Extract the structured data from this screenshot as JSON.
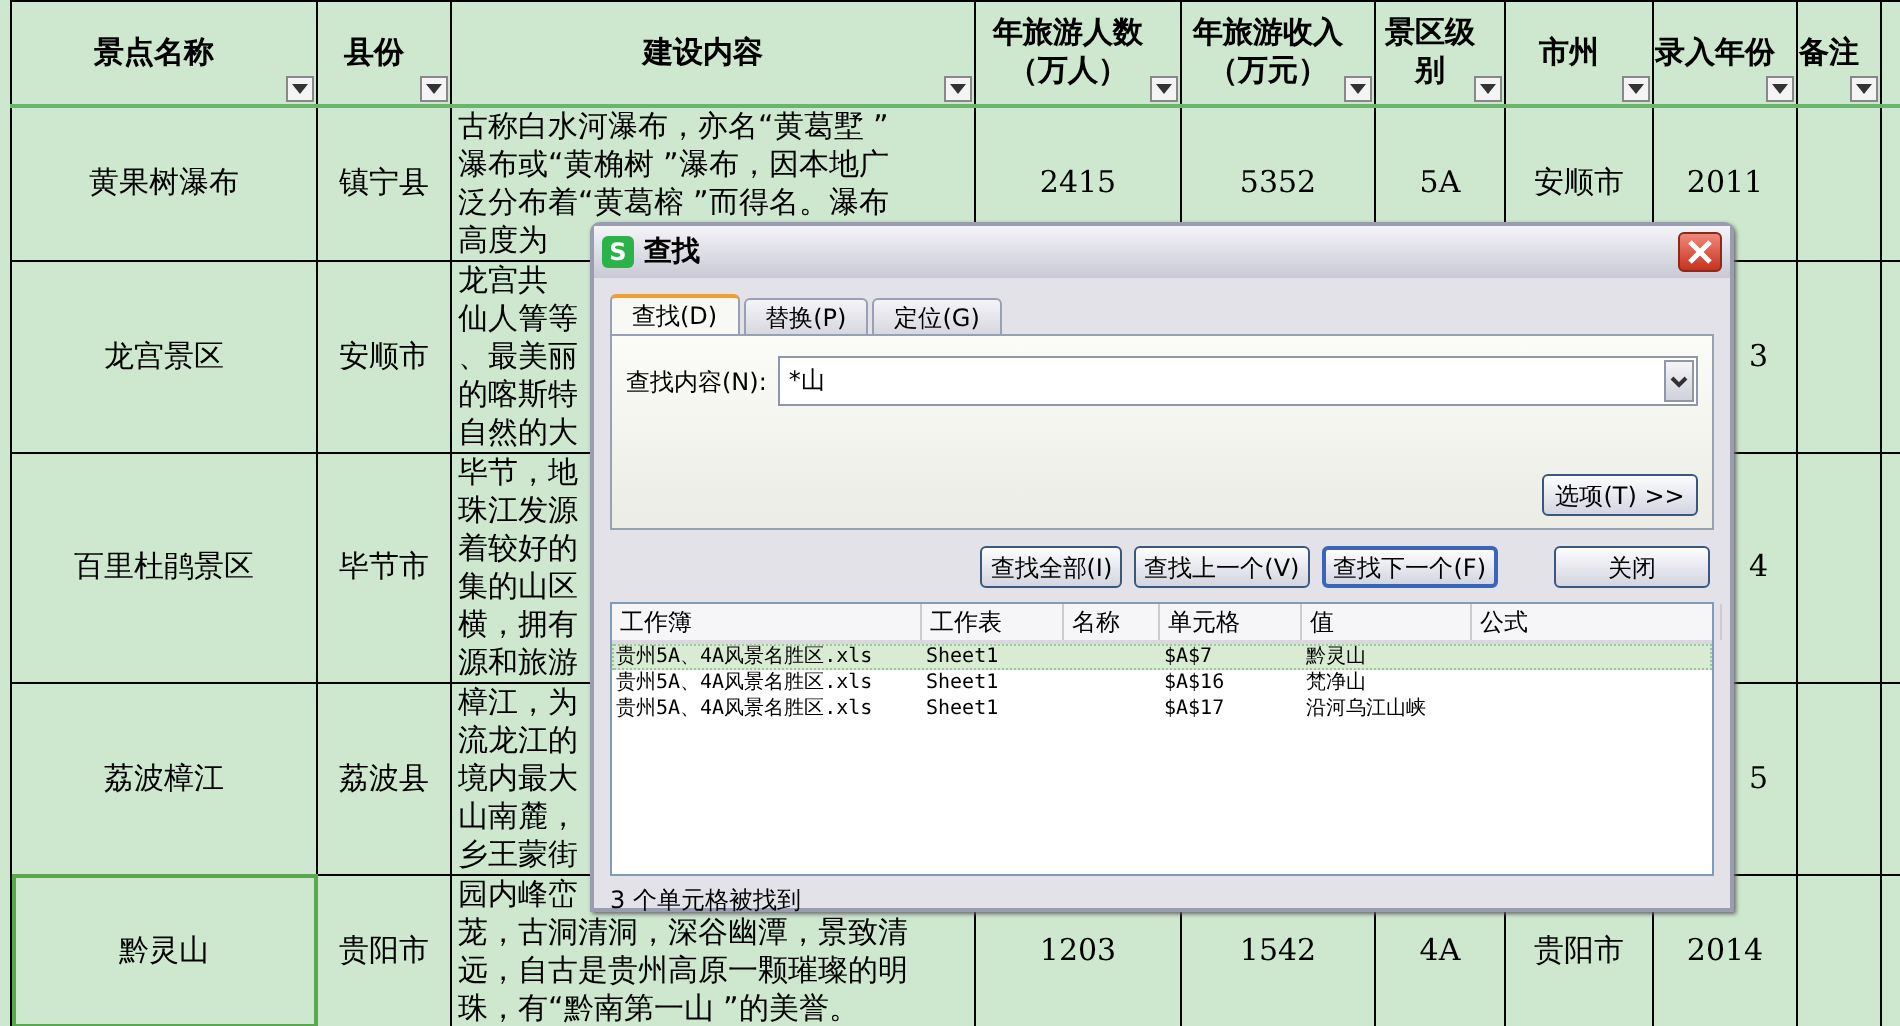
{
  "sheet": {
    "columns": [
      {
        "lines": [
          "景点名称"
        ]
      },
      {
        "lines": [
          "县份"
        ]
      },
      {
        "lines": [
          "建设内容"
        ]
      },
      {
        "lines": [
          "年旅游人数",
          "（万人）"
        ]
      },
      {
        "lines": [
          "年旅游收入",
          "（万元）"
        ]
      },
      {
        "lines": [
          "景区级",
          "别"
        ]
      },
      {
        "lines": [
          "市州"
        ]
      },
      {
        "lines": [
          "录入年份"
        ]
      },
      {
        "lines": [
          "备注"
        ]
      }
    ],
    "rows": [
      {
        "name": "黄果树瀑布",
        "county": "镇宁县",
        "description": [
          "古称白水河瀑布，亦名“黄葛墅 ”",
          "瀑布或“黄桷树 ”瀑布，因本地广",
          "泛分布着“黄葛榕 ”而得名。瀑布",
          "高度为"
        ],
        "visitors": "2415",
        "revenue": "5352",
        "grade": "5A",
        "city": "安顺市",
        "year": "2011",
        "selected": false
      },
      {
        "name": "龙宫景区",
        "county": "安顺市",
        "description": [
          "龙宫共",
          "仙人箐等",
          "、最美丽",
          "的喀斯特",
          "自然的大"
        ],
        "year": "3",
        "selected": false
      },
      {
        "name": "百里杜鹃景区",
        "county": "毕节市",
        "description": [
          "毕节，地",
          "珠江发源",
          "着较好的",
          "集的山区",
          "横，拥有",
          "源和旅游"
        ],
        "year": "4",
        "selected": false
      },
      {
        "name": "荔波樟江",
        "county": "荔波县",
        "description": [
          "樟江，为",
          "流龙江的",
          "境内最大",
          "山南麓，",
          "乡王蒙街"
        ],
        "year": "5",
        "selected": false
      },
      {
        "name": "黔灵山",
        "county": "贵阳市",
        "description": [
          "园内峰峦",
          "茏，古洞清洞，深谷幽潭，景致清",
          "远，自古是贵州高原一颗璀璨的明",
          "珠，有“黔南第一山 ”的美誉。"
        ],
        "visitors": "1203",
        "revenue": "1542",
        "grade": "4A",
        "city": "贵阳市",
        "year": "2014",
        "selected": true
      }
    ]
  },
  "dialog": {
    "app_logo": "S",
    "title": "查找",
    "tabs": [
      {
        "label": "查找(D)",
        "selected": true
      },
      {
        "label": "替换(P)",
        "selected": false
      },
      {
        "label": "定位(G)",
        "selected": false
      }
    ],
    "find_label": "查找内容(N):",
    "find_value": "*山",
    "options_button": "选项(T) >>",
    "buttons": [
      {
        "label": "查找全部(I)",
        "focused": false
      },
      {
        "label": "查找上一个(V)",
        "focused": false
      },
      {
        "label": "查找下一个(F)",
        "focused": true
      }
    ],
    "close_button": "关闭",
    "results": {
      "columns": [
        "工作簿",
        "工作表",
        "名称",
        "单元格",
        "值",
        "公式"
      ],
      "rows": [
        {
          "cells": [
            "贵州5A、4A风景名胜区.xls",
            "Sheet1",
            "",
            "$A$7",
            "黔灵山",
            ""
          ],
          "selected": true
        },
        {
          "cells": [
            "贵州5A、4A风景名胜区.xls",
            "Sheet1",
            "",
            "$A$16",
            "梵净山",
            ""
          ],
          "selected": false
        },
        {
          "cells": [
            "贵州5A、4A风景名胜区.xls",
            "Sheet1",
            "",
            "$A$17",
            "沿河乌江山峡",
            ""
          ],
          "selected": false
        }
      ]
    },
    "status": "3 个单元格被找到"
  }
}
